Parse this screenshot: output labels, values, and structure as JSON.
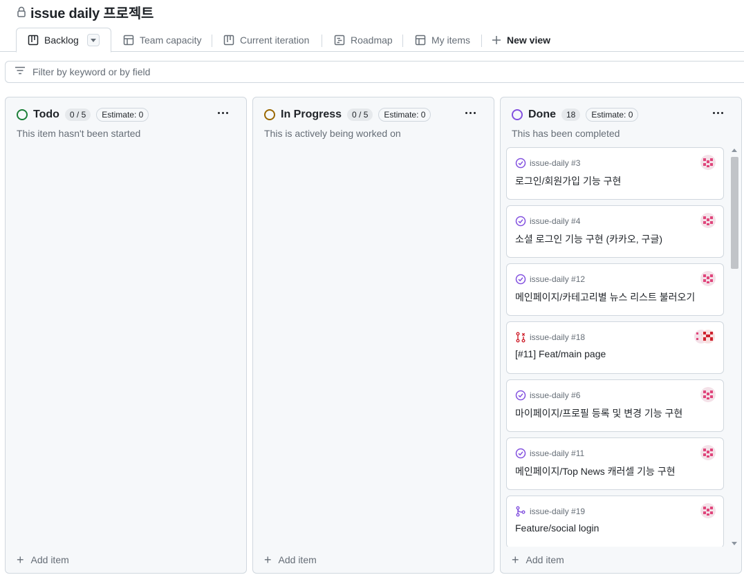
{
  "project": {
    "title": "issue daily 프로젝트",
    "lock_icon": "lock-icon"
  },
  "tabs": [
    {
      "label": "Backlog",
      "icon": "board-icon",
      "active": true
    },
    {
      "label": "Team capacity",
      "icon": "table-icon"
    },
    {
      "label": "Current iteration",
      "icon": "board-icon"
    },
    {
      "label": "Roadmap",
      "icon": "roadmap-icon"
    },
    {
      "label": "My items",
      "icon": "table-icon"
    }
  ],
  "new_view_label": "New view",
  "filter": {
    "placeholder": "Filter by keyword or by field",
    "value": ""
  },
  "columns": [
    {
      "name": "Todo",
      "count": "0 / 5",
      "estimate": "Estimate: 0",
      "description": "This item hasn't been started",
      "status_color": "#1a7f37",
      "add_label": "Add item"
    },
    {
      "name": "In Progress",
      "count": "0 / 5",
      "estimate": "Estimate: 0",
      "description": "This is actively being worked on",
      "status_color": "#9a6700",
      "add_label": "Add item"
    },
    {
      "name": "Done",
      "count": "18",
      "estimate": "Estimate: 0",
      "description": "This has been completed",
      "status_color": "#8250df",
      "add_label": "Add item",
      "cards": [
        {
          "ref": "issue-daily #3",
          "title": "로그인/회원가입 기능 구현",
          "icon": "issue-closed-icon"
        },
        {
          "ref": "issue-daily #4",
          "title": "소셜 로그인 기능 구현 (카카오, 구글)",
          "icon": "issue-closed-icon"
        },
        {
          "ref": "issue-daily #12",
          "title": "메인페이지/카테고리별 뉴스 리스트 불러오기",
          "icon": "issue-closed-icon"
        },
        {
          "ref": "issue-daily #18",
          "title": "[#11] Feat/main page",
          "icon": "pull-request-closed-icon"
        },
        {
          "ref": "issue-daily #6",
          "title": "마이페이지/프로필 등록 및 변경 기능 구현",
          "icon": "issue-closed-icon"
        },
        {
          "ref": "issue-daily #11",
          "title": "메인페이지/Top News 캐러셀 기능 구현",
          "icon": "issue-closed-icon"
        },
        {
          "ref": "issue-daily #19",
          "title": "Feature/social login",
          "icon": "pull-request-merged-icon"
        }
      ]
    }
  ],
  "colors": {
    "done_purple": "#8250df",
    "closed_red": "#cf222e",
    "avatar_pink": "#e0457b"
  }
}
